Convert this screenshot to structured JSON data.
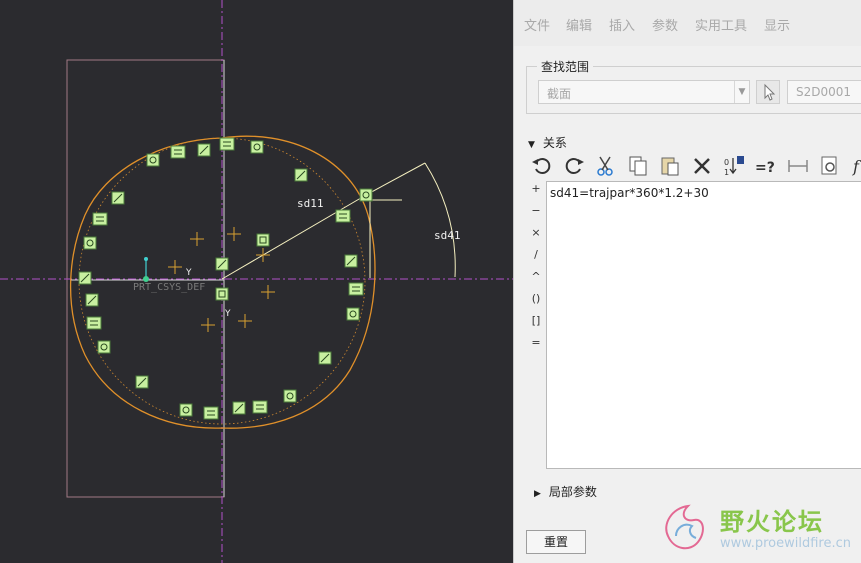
{
  "menu": {
    "items": [
      "文件",
      "编辑",
      "插入",
      "参数",
      "实用工具",
      "显示"
    ]
  },
  "scope": {
    "legend": "查找范围",
    "selected": "截面",
    "section_id": "S2D0001"
  },
  "relations": {
    "header": "关系",
    "side_ops": [
      "+",
      "−",
      "×",
      "/",
      "^",
      "()",
      "[]",
      "="
    ],
    "text": "sd41=trajpar*360*1.2+30"
  },
  "local_params": {
    "header": "局部参数"
  },
  "reset_label": "重置",
  "canvas": {
    "csys_label": "PRT_CSYS_DEF",
    "dim_sd11": "sd11",
    "dim_sd41": "sd41",
    "axis_y": "Y",
    "axis_y2": "Y"
  },
  "watermark": {
    "title": "野火论坛",
    "url": "www.proewildfire.cn"
  },
  "colors": {
    "canvas_bg": "#2b2b2f",
    "sketch_orange": "#e0902a",
    "constraint_green": "#c8f0a0",
    "accent_magenta": "#b040c0",
    "panel_bg": "#f0f0f0"
  }
}
